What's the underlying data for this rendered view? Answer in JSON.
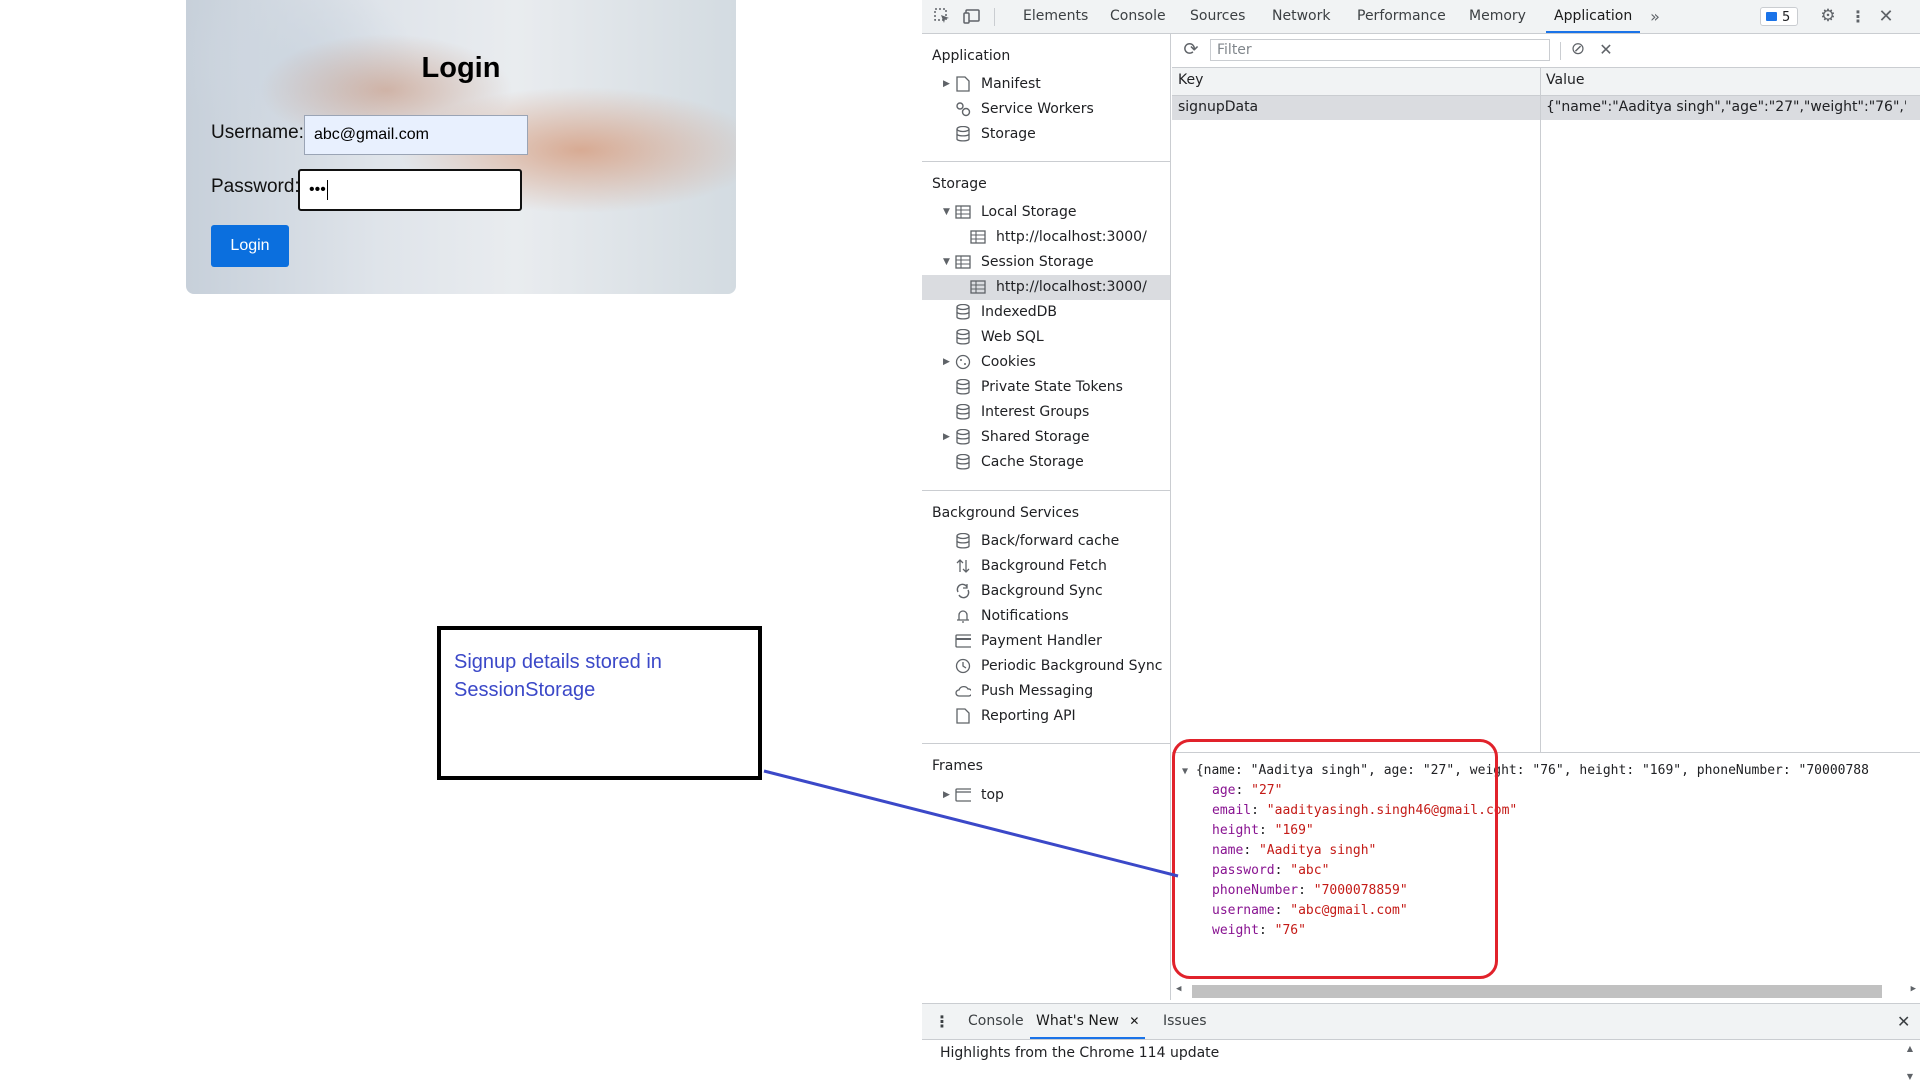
{
  "login": {
    "title": "Login",
    "username_label": "Username:",
    "username_value": "abc@gmail.com",
    "password_label": "Password:",
    "password_value": "•••",
    "button_label": "Login"
  },
  "annotation": {
    "line1": "Signup details stored in",
    "line2": "SessionStorage",
    "color": "#3b48c8"
  },
  "devtools": {
    "tabs": [
      "Elements",
      "Console",
      "Sources",
      "Network",
      "Performance",
      "Memory",
      "Application"
    ],
    "active_tab": "Application",
    "issues_count": "5",
    "sidebar": {
      "application_title": "Application",
      "application_items": [
        "Manifest",
        "Service Workers",
        "Storage"
      ],
      "storage_title": "Storage",
      "storage_items": [
        "Local Storage",
        "http://localhost:3000/",
        "Session Storage",
        "http://localhost:3000/",
        "IndexedDB",
        "Web SQL",
        "Cookies",
        "Private State Tokens",
        "Interest Groups",
        "Shared Storage",
        "Cache Storage"
      ],
      "bg_title": "Background Services",
      "bg_items": [
        "Back/forward cache",
        "Background Fetch",
        "Background Sync",
        "Notifications",
        "Payment Handler",
        "Periodic Background Sync",
        "Push Messaging",
        "Reporting API"
      ],
      "frames_title": "Frames",
      "frames_items": [
        "top"
      ]
    },
    "filter_placeholder": "Filter",
    "table": {
      "headers": [
        "Key",
        "Value"
      ],
      "rows": [
        {
          "key": "signupData",
          "value": "{\"name\":\"Aaditya singh\",\"age\":\"27\",\"weight\":\"76\",\"h..."
        }
      ]
    },
    "preview": {
      "summary": "{name: \"Aaditya singh\", age: \"27\", weight: \"76\", height: \"169\", phoneNumber: \"70000788",
      "fields": [
        {
          "key": "age",
          "value": "\"27\""
        },
        {
          "key": "email",
          "value": "\"aadityasingh.singh46@gmail.com\""
        },
        {
          "key": "height",
          "value": "\"169\""
        },
        {
          "key": "name",
          "value": "\"Aaditya singh\""
        },
        {
          "key": "password",
          "value": "\"abc\""
        },
        {
          "key": "phoneNumber",
          "value": "\"7000078859\""
        },
        {
          "key": "username",
          "value": "\"abc@gmail.com\""
        },
        {
          "key": "weight",
          "value": "\"76\""
        }
      ]
    },
    "drawer": {
      "tabs": [
        "Console",
        "What's New",
        "Issues"
      ],
      "active_tab": "What's New",
      "message": "Highlights from the Chrome 114 update"
    }
  }
}
